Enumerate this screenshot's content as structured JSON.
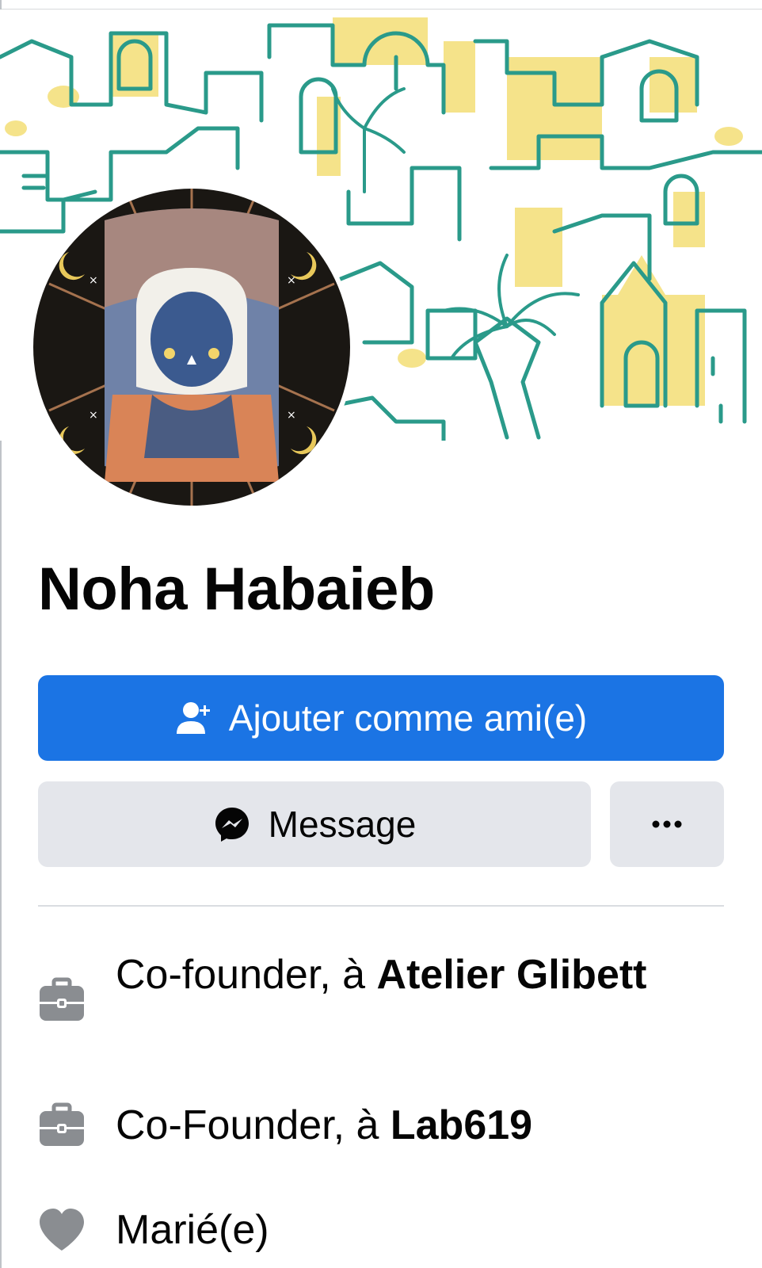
{
  "profile": {
    "name": "Noha Habaieb"
  },
  "actions": {
    "add_friend_label": "Ajouter comme ami(e)",
    "message_label": "Message",
    "more_label": "..."
  },
  "intro": {
    "items": [
      {
        "icon": "briefcase-icon",
        "prefix": "Co-founder, à ",
        "bold": "Atelier Glibett"
      },
      {
        "icon": "briefcase-icon",
        "prefix": "Co-Founder, à ",
        "bold": "Lab619"
      },
      {
        "icon": "heart-icon",
        "prefix": "Marié(e)",
        "bold": ""
      }
    ]
  },
  "colors": {
    "primary": "#1b74e4",
    "secondary_bg": "#e4e6eb",
    "icon_gray": "#8a8d91",
    "cover_teal": "#2a9a8a",
    "cover_yellow": "#f5e38a"
  }
}
